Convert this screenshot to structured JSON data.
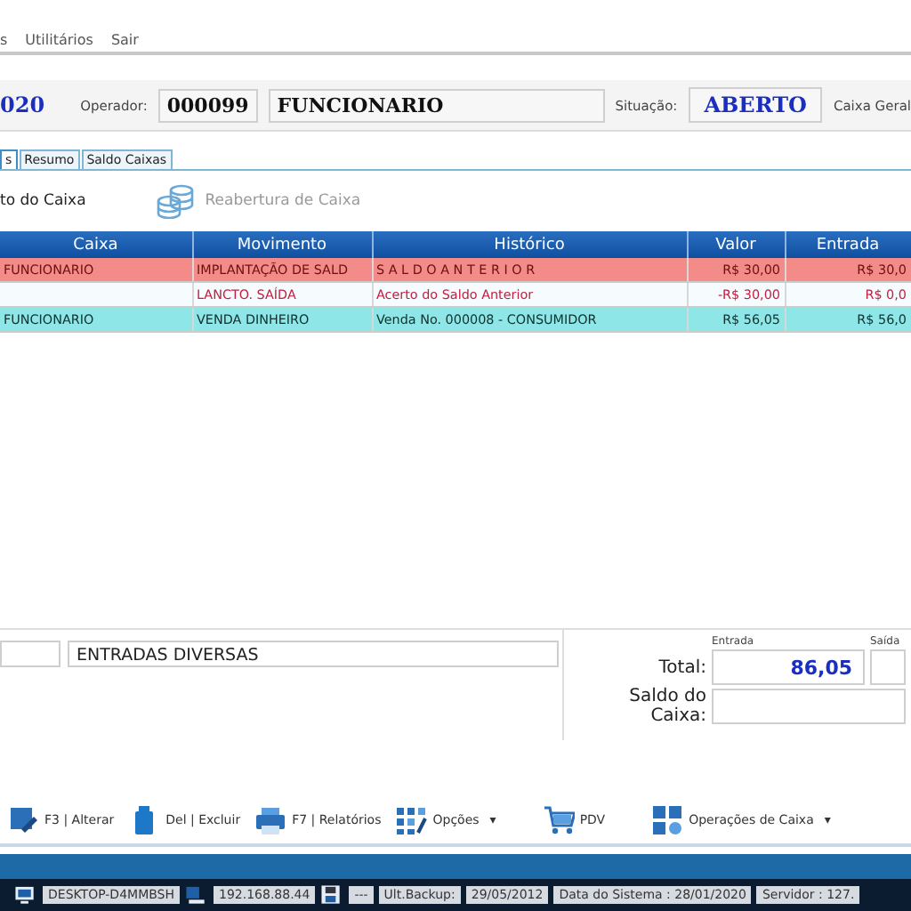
{
  "menu": [
    "s",
    "Utilitários",
    "Sair"
  ],
  "header": {
    "date_fragment": "020",
    "operator_label": "Operador:",
    "operator_code": "000099",
    "operator_name": "FUNCIONARIO",
    "status_label": "Situação:",
    "status": "ABERTO",
    "register": "Caixa Geral"
  },
  "tabs": [
    {
      "label": "s",
      "selected": true
    },
    {
      "label": "Resumo",
      "selected": false
    },
    {
      "label": "Saldo Caixas",
      "selected": false
    }
  ],
  "actions": [
    {
      "label": "to do Caixa",
      "disabled": false,
      "kind": "text"
    },
    {
      "label": "Reabertura de Caixa",
      "disabled": true,
      "kind": "coins"
    }
  ],
  "table": {
    "columns": [
      "Caixa",
      "Movimento",
      "Histórico",
      "Valor",
      "Entrada"
    ],
    "rows": [
      {
        "kind": "opening",
        "cells": [
          "FUNCIONARIO",
          "IMPLANTAÇÃO DE SALD",
          "S A L D O   A N T E R I O R",
          "R$ 30,00",
          "R$ 30,0"
        ]
      },
      {
        "kind": "withdrawal",
        "cells": [
          "",
          "LANCTO. SAÍDA",
          "Acerto do Saldo Anterior",
          "-R$ 30,00",
          "R$ 0,0"
        ]
      },
      {
        "kind": "sale",
        "cells": [
          "FUNCIONARIO",
          "VENDA DINHEIRO",
          "Venda No. 000008 - CONSUMIDOR",
          "R$ 56,05",
          "R$ 56,0"
        ]
      }
    ]
  },
  "details": {
    "description": "ENTRADAS DIVERSAS"
  },
  "totals": {
    "entrada_label": "Entrada",
    "saida_label": "Saída",
    "total_label": "Total:",
    "total_entrada": "86,05",
    "saldo_label": "Saldo do Caixa:"
  },
  "toolbar": [
    {
      "label": "F3 | Alterar",
      "kind": "edit"
    },
    {
      "label": "Del | Excluir",
      "kind": "trash"
    },
    {
      "label": "F7 | Relatórios",
      "kind": "printer"
    },
    {
      "label": "Opções",
      "kind": "options",
      "caret": "▾"
    },
    {
      "label": "PDV",
      "kind": "cart"
    },
    {
      "label": "Operações de Caixa",
      "kind": "grid",
      "caret": "▾"
    }
  ],
  "status_bar": [
    {
      "kind": "computer",
      "text": "DESKTOP-D4MMBSH"
    },
    {
      "kind": "network",
      "text": "192.168.88.44"
    },
    {
      "kind": "disk",
      "text": "---"
    },
    {
      "kind": "text",
      "text": "Ult.Backup:"
    },
    {
      "kind": "text",
      "text": "29/05/2012"
    },
    {
      "kind": "text",
      "text": "Data do Sistema : 28/01/2020"
    },
    {
      "kind": "text",
      "text": "Servidor : 127."
    }
  ]
}
